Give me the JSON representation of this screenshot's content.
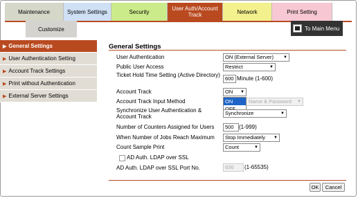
{
  "tabs": [
    "Maintenance",
    "System Settings",
    "Security",
    "User Auth/Account Track",
    "Network",
    "Print Setting",
    ""
  ],
  "customize": "Customize",
  "to_main_menu": "To Main Menu",
  "sidebar": [
    {
      "label": "General Settings",
      "active": true
    },
    {
      "label": "User Authentication Setting",
      "active": false
    },
    {
      "label": "Account Track Settings",
      "active": false
    },
    {
      "label": "Print without Authentication",
      "active": false
    },
    {
      "label": "External Server Settings",
      "active": false
    }
  ],
  "main": {
    "title": "General Settings",
    "user_authentication": {
      "label": "User Authentication",
      "value": "ON (External Server)"
    },
    "public_user_access": {
      "label": "Public User Access",
      "value": "Restrict"
    },
    "ticket_hold_time": {
      "label": "Ticket Hold Time Setting (Active Directory)",
      "value": "600",
      "unit": "Minute (1-600)"
    },
    "account_track": {
      "label": "Account Track",
      "value": "ON",
      "options": [
        "ON",
        "OFF"
      ]
    },
    "account_track_input": {
      "label": "Account Track Input Method",
      "value": "Name & Password"
    },
    "synchronize": {
      "label": "Synchronize User Authentication & Account Track",
      "value": "Synchronize"
    },
    "counters": {
      "label": "Number of Counters Assigned for Users",
      "value": "500",
      "unit": "(1-999)"
    },
    "jobs_max": {
      "label": "When Number of Jobs Reach Maximum",
      "value": "Stop Immediately"
    },
    "count_sample": {
      "label": "Count Sample Print",
      "value": "Count"
    },
    "ad_auth_ssl": {
      "label": "AD Auth. LDAP over SSL"
    },
    "ad_auth_port": {
      "label": "AD Auth. LDAP over SSL Port No.",
      "value": "636",
      "unit": "(1-65535)"
    }
  },
  "buttons": {
    "ok": "OK",
    "cancel": "Cancel"
  }
}
